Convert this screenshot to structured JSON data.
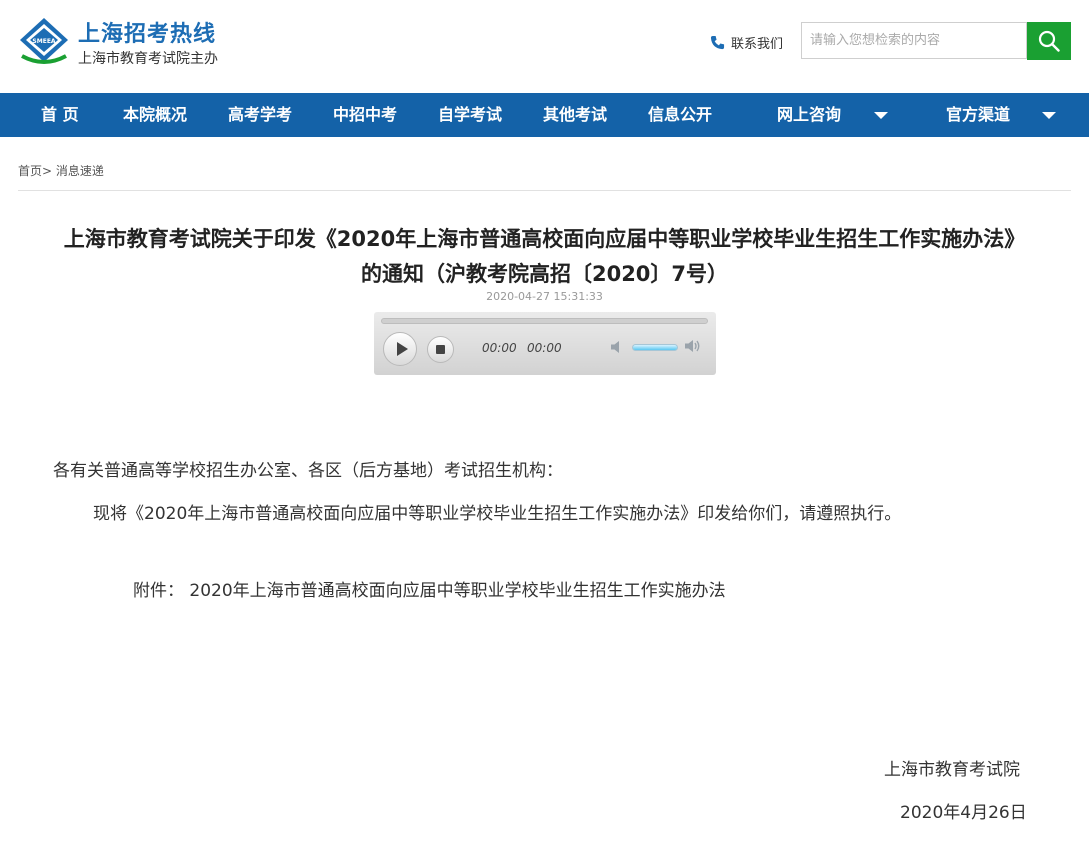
{
  "header": {
    "logo_badge": "SMEEA",
    "site_title": "上海招考热线",
    "site_subtitle": "上海市教育考试院主办",
    "contact_label": "联系我们",
    "search_placeholder": "请输入您想检索的内容",
    "search_icon": "magnifier-icon",
    "accent_green": "#1aa032"
  },
  "nav": {
    "background": "#1462a8",
    "items": [
      {
        "label": "首 页"
      },
      {
        "label": "本院概况"
      },
      {
        "label": "高考学考"
      },
      {
        "label": "中招中考"
      },
      {
        "label": "自学考试"
      },
      {
        "label": "其他考试"
      },
      {
        "label": "信息公开"
      },
      {
        "label": "网上咨询",
        "dropdown": true
      },
      {
        "label": "官方渠道",
        "dropdown": true
      }
    ]
  },
  "breadcrumb": {
    "home": "首页",
    "separator": ">",
    "current": "消息速递"
  },
  "article": {
    "title_line1": "上海市教育考试院关于印发《2020年上海市普通高校面向应届中等职业学校毕业生招生工作实施办法》",
    "title_line2": "的通知（沪教考院高招〔2020〕7号）",
    "date": "2020-04-27 15:31:33",
    "audio": {
      "current_time": "00:00",
      "duration": "00:00",
      "volume": 0.7
    },
    "salutation": "各有关普通高等学校招生办公室、各区（后方基地）考试招生机构：",
    "body": "现将《2020年上海市普通高校面向应届中等职业学校毕业生招生工作实施办法》印发给你们，请遵照执行。",
    "attachment_label": "附件：",
    "attachment_name": "2020年上海市普通高校面向应届中等职业学校毕业生招生工作实施办法",
    "signature": "上海市教育考试院",
    "sign_date": "2020年4月26日"
  }
}
